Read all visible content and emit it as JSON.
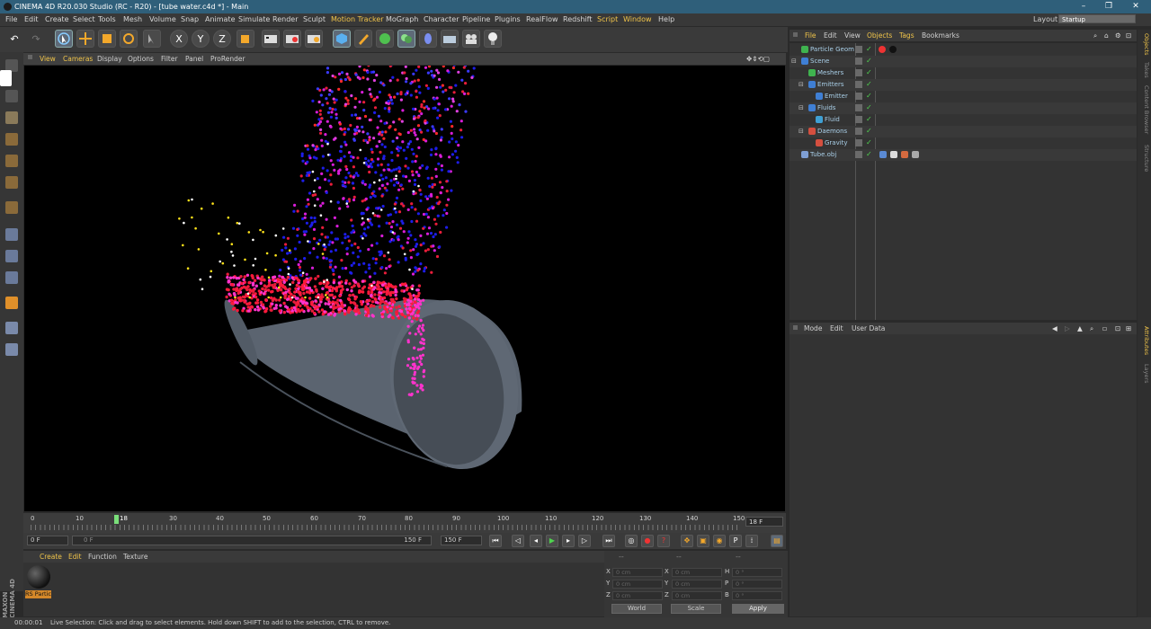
{
  "window": {
    "title": "CINEMA 4D R20.030 Studio (RC - R20) - [tube water.c4d *] - Main",
    "minimize": "–",
    "maximize": "❐",
    "close": "✕"
  },
  "menubar": {
    "items": [
      "File",
      "Edit",
      "Create",
      "Select",
      "Tools",
      "Mesh",
      "Volume",
      "Snap",
      "Animate",
      "Simulate",
      "Render",
      "Sculpt",
      "Motion Tracker",
      "MoGraph",
      "Character",
      "Pipeline",
      "Plugins",
      "RealFlow",
      "Redshift",
      "Script",
      "Window",
      "Help"
    ],
    "layout_label": "Layout:",
    "layout_value": "Startup"
  },
  "toolbar": {
    "axis_x": "X",
    "axis_y": "Y",
    "axis_z": "Z"
  },
  "viewport": {
    "menu": [
      "View",
      "Cameras",
      "Display",
      "Options",
      "Filter",
      "Panel",
      "ProRender"
    ]
  },
  "timeline": {
    "ticks": [
      "0",
      "10",
      "18",
      "30",
      "40",
      "50",
      "60",
      "70",
      "80",
      "90",
      "100",
      "110",
      "120",
      "130",
      "140",
      "150"
    ],
    "current_frame": "18 F"
  },
  "playback": {
    "start": "0 F",
    "range_start": "0 F",
    "range_end": "150 F",
    "end": "150 F"
  },
  "materials": {
    "menu": [
      "Create",
      "Edit",
      "Function",
      "Texture"
    ],
    "material_name": "RS Partic"
  },
  "coordinates": {
    "header": "--",
    "rows": [
      {
        "a": "X",
        "av": "0 cm",
        "b": "X",
        "bv": "0 cm",
        "c": "H",
        "cv": "0 °"
      },
      {
        "a": "Y",
        "av": "0 cm",
        "b": "Y",
        "bv": "0 cm",
        "c": "P",
        "cv": "0 °"
      },
      {
        "a": "Z",
        "av": "0 cm",
        "b": "Z",
        "bv": "0 cm",
        "c": "B",
        "cv": "0 °"
      }
    ],
    "space": "World",
    "mode": "Scale",
    "apply": "Apply"
  },
  "objects": {
    "menu": [
      "File",
      "Edit",
      "View",
      "Objects",
      "Tags",
      "Bookmarks"
    ],
    "items": [
      {
        "name": "Particle Geom",
        "indent": 0,
        "color": "#3fb34f"
      },
      {
        "name": "Scene",
        "indent": 0,
        "color": "#3f7fd4"
      },
      {
        "name": "Meshers",
        "indent": 1,
        "color": "#3fb34f"
      },
      {
        "name": "Emitters",
        "indent": 1,
        "color": "#3f7fd4"
      },
      {
        "name": "Emitter",
        "indent": 2,
        "color": "#3f7fd4"
      },
      {
        "name": "Fluids",
        "indent": 1,
        "color": "#3f7fd4"
      },
      {
        "name": "Fluid",
        "indent": 2,
        "color": "#3fa0d4"
      },
      {
        "name": "Daemons",
        "indent": 1,
        "color": "#d44f3f"
      },
      {
        "name": "Gravity",
        "indent": 2,
        "color": "#d44f3f"
      },
      {
        "name": "Tube.obj",
        "indent": 0,
        "color": "#7f9fd4"
      }
    ]
  },
  "attributes": {
    "menu": [
      "Mode",
      "Edit",
      "User Data"
    ]
  },
  "right_tabs": [
    "Objects",
    "Takes",
    "Content Browser",
    "Structure",
    "Attributes",
    "Layers"
  ],
  "status": {
    "time": "00:00:01",
    "message": "Live Selection: Click and drag to select elements. Hold down SHIFT to add to the selection, CTRL to remove."
  },
  "brand": {
    "maxon": "MAXON",
    "cinema": "CINEMA 4D"
  },
  "colors": {
    "accent": "#f0c44a",
    "titlebar": "#2f5f7a",
    "tube": "#5b6470"
  }
}
